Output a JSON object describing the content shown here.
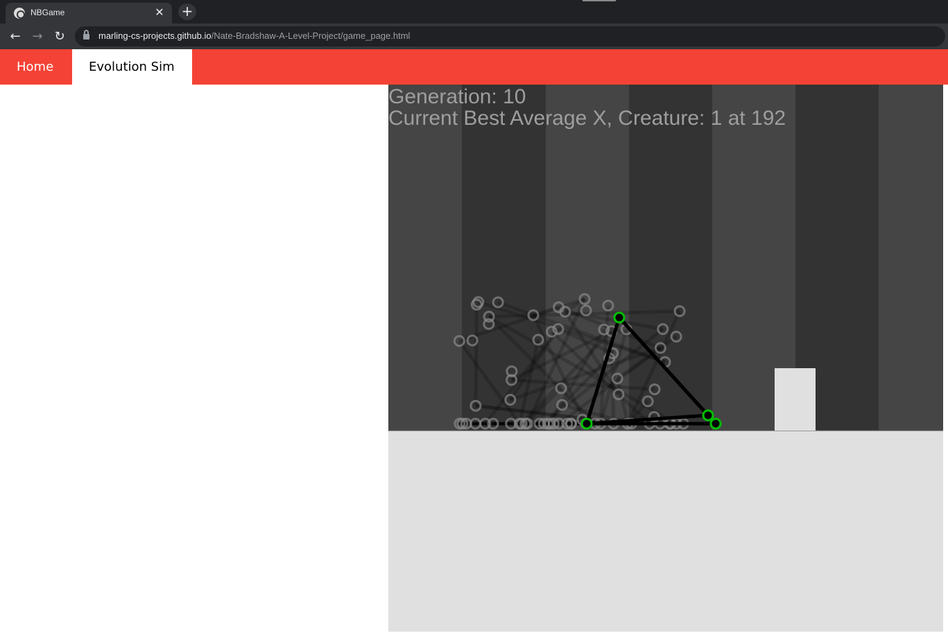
{
  "browser": {
    "tab_title": "NBGame",
    "tab_close": "✕",
    "new_tab": "+",
    "back": "←",
    "forward": "→",
    "reload": "↻",
    "url_host": "marling-cs-projects.github.io",
    "url_path": "/Nate-Bradshaw-A-Level-Project/game_page.html"
  },
  "site_nav": {
    "items": [
      {
        "label": "Home",
        "active": false
      },
      {
        "label": "Evolution Sim",
        "active": true
      }
    ],
    "bar_color": "#f44336"
  },
  "game": {
    "generation_text": "Generation: 10",
    "best_text": "Current Best Average X, Creature: 1 at 192",
    "colors": {
      "stripe_light": "#454545",
      "stripe_dark": "#333333",
      "ground": "#e0e0e0",
      "goal_block": "#e0e0e0",
      "node_highlight": "#00c000",
      "muscle": "#000000",
      "hud_text": "#9e9e9e"
    }
  }
}
